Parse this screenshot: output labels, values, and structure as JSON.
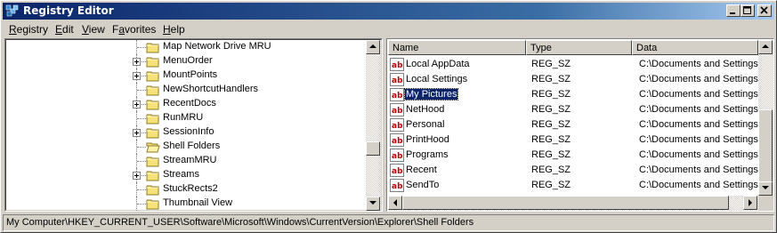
{
  "window": {
    "title": "Registry Editor",
    "icon": "registry-editor-icon"
  },
  "menubar": {
    "items": [
      {
        "label": "Registry",
        "accel": "R"
      },
      {
        "label": "Edit",
        "accel": "E"
      },
      {
        "label": "View",
        "accel": "V"
      },
      {
        "label": "Favorites",
        "accel": "a"
      },
      {
        "label": "Help",
        "accel": "H"
      }
    ]
  },
  "tree": {
    "items": [
      {
        "label": "Map Network Drive MRU",
        "expandable": false,
        "open": false
      },
      {
        "label": "MenuOrder",
        "expandable": true,
        "open": false
      },
      {
        "label": "MountPoints",
        "expandable": true,
        "open": false
      },
      {
        "label": "NewShortcutHandlers",
        "expandable": false,
        "open": false
      },
      {
        "label": "RecentDocs",
        "expandable": true,
        "open": false
      },
      {
        "label": "RunMRU",
        "expandable": false,
        "open": false
      },
      {
        "label": "SessionInfo",
        "expandable": true,
        "open": false
      },
      {
        "label": "Shell Folders",
        "expandable": false,
        "open": true
      },
      {
        "label": "StreamMRU",
        "expandable": false,
        "open": false
      },
      {
        "label": "Streams",
        "expandable": true,
        "open": false
      },
      {
        "label": "StuckRects2",
        "expandable": false,
        "open": false
      },
      {
        "label": "Thumbnail View",
        "expandable": false,
        "open": false
      }
    ]
  },
  "list": {
    "columns": [
      "Name",
      "Type",
      "Data"
    ],
    "rows": [
      {
        "name": "Local AppData",
        "type": "REG_SZ",
        "data": "C:\\Documents and Settings\\",
        "selected": false
      },
      {
        "name": "Local Settings",
        "type": "REG_SZ",
        "data": "C:\\Documents and Settings\\",
        "selected": false
      },
      {
        "name": "My Pictures",
        "type": "REG_SZ",
        "data": "C:\\Documents and Settings\\",
        "selected": true
      },
      {
        "name": "NetHood",
        "type": "REG_SZ",
        "data": "C:\\Documents and Settings\\",
        "selected": false
      },
      {
        "name": "Personal",
        "type": "REG_SZ",
        "data": "C:\\Documents and Settings\\",
        "selected": false
      },
      {
        "name": "PrintHood",
        "type": "REG_SZ",
        "data": "C:\\Documents and Settings\\",
        "selected": false
      },
      {
        "name": "Programs",
        "type": "REG_SZ",
        "data": "C:\\Documents and Settings\\",
        "selected": false
      },
      {
        "name": "Recent",
        "type": "REG_SZ",
        "data": "C:\\Documents and Settings\\",
        "selected": false
      },
      {
        "name": "SendTo",
        "type": "REG_SZ",
        "data": "C:\\Documents and Settings\\",
        "selected": false
      }
    ]
  },
  "statusbar": {
    "path": "My Computer\\HKEY_CURRENT_USER\\Software\\Microsoft\\Windows\\CurrentVersion\\Explorer\\Shell Folders"
  },
  "colors": {
    "title_start": "#0a246a",
    "title_end": "#a6caf0",
    "selection": "#0a246a",
    "face": "#d4d0c8"
  }
}
